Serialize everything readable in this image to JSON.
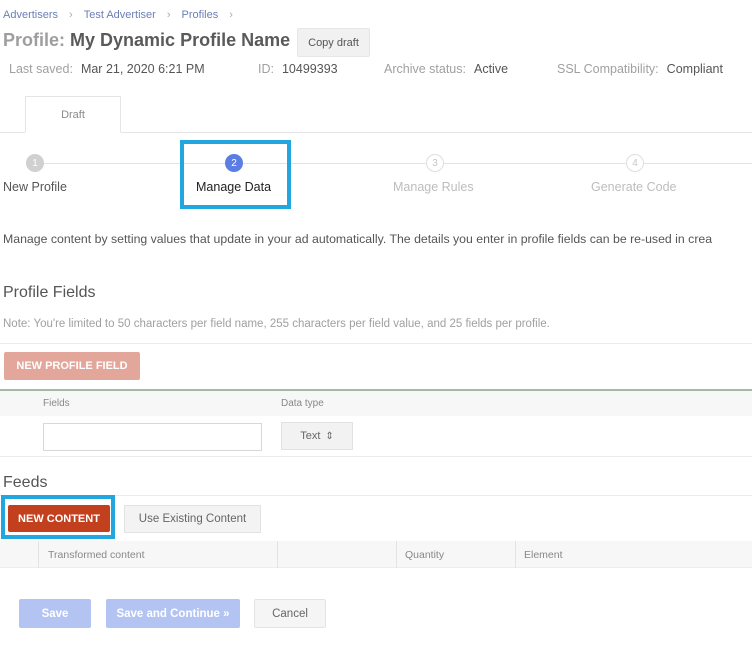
{
  "breadcrumb": {
    "items": [
      "Advertisers",
      "Test Advertiser",
      "Profiles"
    ],
    "separator": "›"
  },
  "header": {
    "title_prefix": "Profile:",
    "title_name": "My Dynamic Profile Name",
    "copy_label": "Copy draft"
  },
  "meta": {
    "last_saved_label": "Last saved:",
    "last_saved_value": "Mar 21, 2020 6:21 PM",
    "id_label": "ID:",
    "id_value": "10499393",
    "archive_label": "Archive status:",
    "archive_value": "Active",
    "ssl_label": "SSL Compatibility:",
    "ssl_value": "Compliant"
  },
  "tabs": {
    "draft": "Draft"
  },
  "steps": [
    {
      "number": "1",
      "label": "New Profile",
      "state": "done"
    },
    {
      "number": "2",
      "label": "Manage Data",
      "state": "active"
    },
    {
      "number": "3",
      "label": "Manage Rules",
      "state": "todo"
    },
    {
      "number": "4",
      "label": "Generate Code",
      "state": "todo"
    }
  ],
  "description": "Manage content by setting values that update in your ad automatically. The details you enter in profile fields can be re-used in crea",
  "profile_fields": {
    "title": "Profile Fields",
    "note": "Note: You're limited to 50 characters per field name, 255 characters per field value, and 25 fields per profile.",
    "new_button": "NEW PROFILE FIELD",
    "col_fields": "Fields",
    "col_data_type": "Data type",
    "field_value": "",
    "data_type_value": "Text",
    "data_type_arrow": "⇕"
  },
  "feeds": {
    "title": "Feeds",
    "new_button": "NEW CONTENT",
    "existing_button": "Use Existing Content",
    "col_transformed": "Transformed content",
    "col_quantity": "Quantity",
    "col_element": "Element"
  },
  "footer": {
    "save": "Save",
    "save_continue": "Save and Continue »",
    "cancel": "Cancel"
  },
  "colors": {
    "accent_blue": "#5b7ee5",
    "highlight": "#22a6e0",
    "new_content": "#c2401e",
    "new_profile_field": "#e3a69a"
  }
}
